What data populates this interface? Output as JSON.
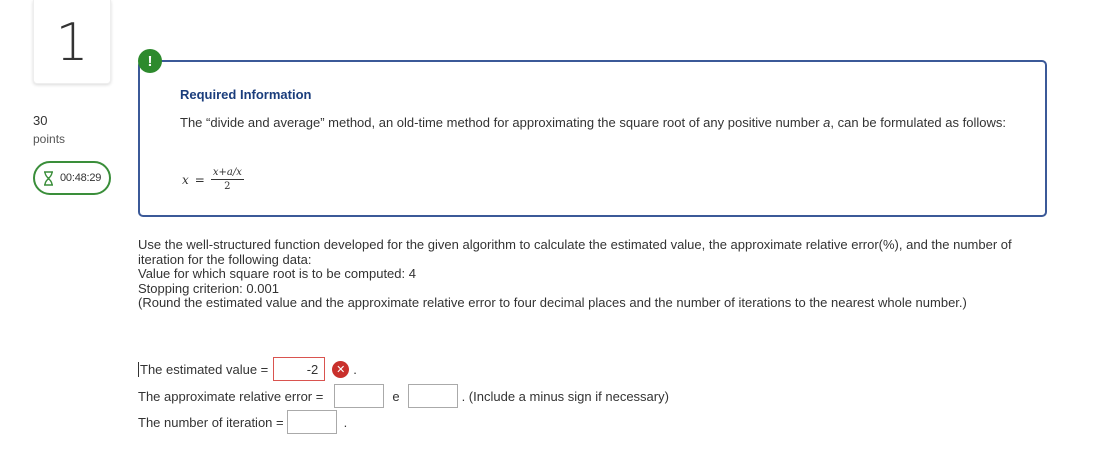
{
  "question": {
    "number": "1",
    "points_value": "30",
    "points_label": "points",
    "timer": "00:48:29"
  },
  "alert_symbol": "!",
  "required_info": {
    "title": "Required Information",
    "text_part1": "The “divide and average” method, an old-time method for approximating the square root of any positive number ",
    "text_var": "a",
    "text_part2": ", can be formulated as follows:",
    "formula": {
      "lhs": "x",
      "eq": "=",
      "numerator": "x+a/x",
      "denominator": "2"
    }
  },
  "problem": {
    "line1": "Use the well-structured function developed for the given algorithm to calculate the estimated value, the approximate relative error(%), and the number of iteration for the following data:",
    "line2": "Value for which square root is to be computed: 4",
    "line3": "Stopping criterion: 0.001",
    "line4": "(Round the estimated value and the approximate relative error to four decimal places and the number of iterations to the nearest whole number.)"
  },
  "answers": {
    "estimated_label": "The estimated value =",
    "estimated_value": "-2",
    "estimated_status": "incorrect",
    "period": ".",
    "relative_error_label": "The approximate relative error =",
    "relative_error_mantissa": "",
    "exponent_symbol": "e",
    "relative_error_exponent": "",
    "relative_error_hint": ". (Include a minus sign if necessary)",
    "iteration_label": "The number of iteration =",
    "iteration_value": ""
  },
  "colors": {
    "accent_green": "#2d8a2d",
    "info_border": "#3b5998",
    "error_red": "#c9302c"
  },
  "icons": {
    "timer": "hourglass-icon",
    "alert": "exclamation-icon",
    "incorrect": "x-circle-icon"
  }
}
